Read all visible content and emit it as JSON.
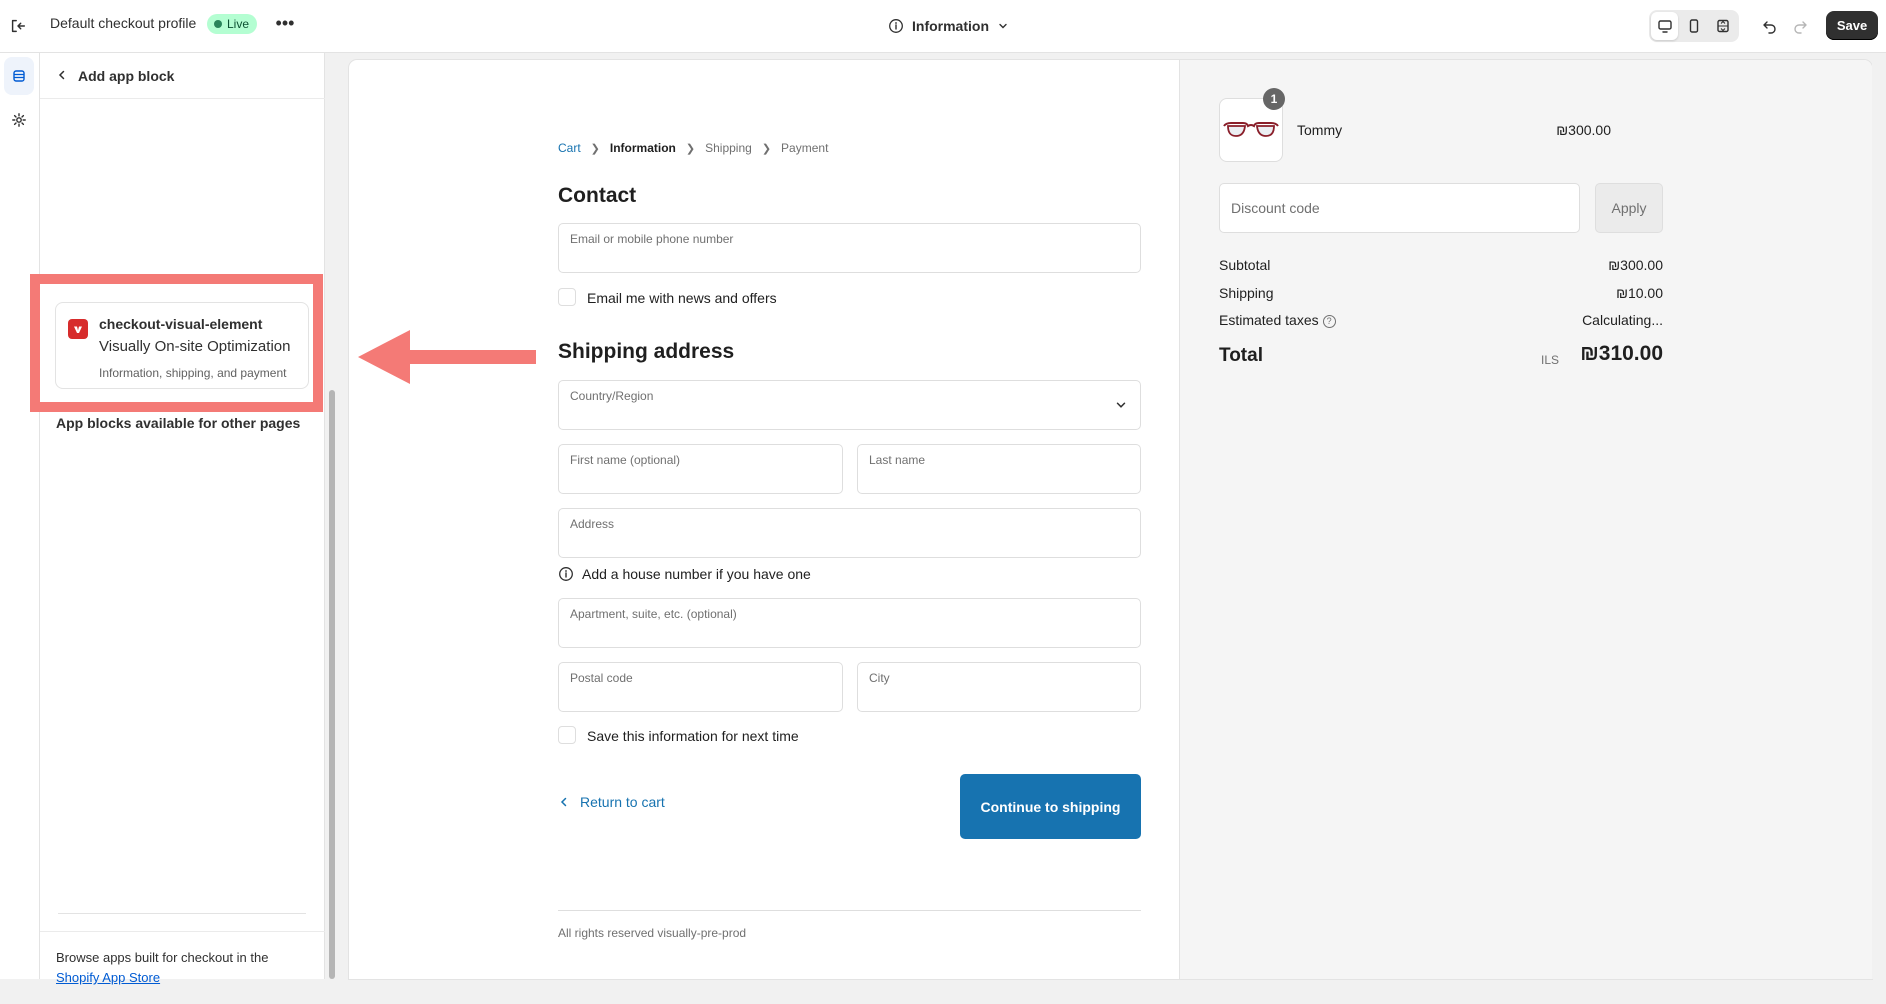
{
  "topbar": {
    "title": "Default checkout profile",
    "live_label": "Live",
    "more_icon": "more-horizontal-icon",
    "page_selector": "Information",
    "save_label": "Save"
  },
  "panel": {
    "header_title": "Add app block",
    "app_block": {
      "name": "checkout-visual-element",
      "subtitle": "Visually On-site Optimization",
      "description": "Information, shipping, and payment"
    },
    "other_pages_heading": "App blocks available for other pages",
    "footer_text": "Browse apps built for checkout in the",
    "footer_link": "Shopify App Store"
  },
  "checkout": {
    "breadcrumbs": {
      "cart": "Cart",
      "information": "Information",
      "shipping": "Shipping",
      "payment": "Payment"
    },
    "contact_heading": "Contact",
    "email_label": "Email or mobile phone number",
    "news_checkbox": "Email me with news and offers",
    "shipping_heading": "Shipping address",
    "country_label": "Country/Region",
    "first_name_label": "First name (optional)",
    "last_name_label": "Last name",
    "address_label": "Address",
    "address_hint": "Add a house number if you have one",
    "apartment_label": "Apartment, suite, etc. (optional)",
    "postal_label": "Postal code",
    "city_label": "City",
    "save_info_checkbox": "Save this information for next time",
    "return_link": "Return to cart",
    "continue_button": "Continue to shipping",
    "footer": "All rights reserved visually-pre-prod"
  },
  "summary": {
    "quantity": "1",
    "product_name": "Tommy",
    "product_price": "₪300.00",
    "discount_placeholder": "Discount code",
    "apply_label": "Apply",
    "subtotal_label": "Subtotal",
    "subtotal_value": "₪300.00",
    "shipping_label": "Shipping",
    "shipping_value": "₪10.00",
    "taxes_label": "Estimated taxes",
    "taxes_value": "Calculating...",
    "total_label": "Total",
    "total_currency": "ILS",
    "total_value": "₪310.00"
  },
  "colors": {
    "accent": "#1773b0",
    "highlight": "#f47a76",
    "live_badge": "#b4fed2"
  }
}
